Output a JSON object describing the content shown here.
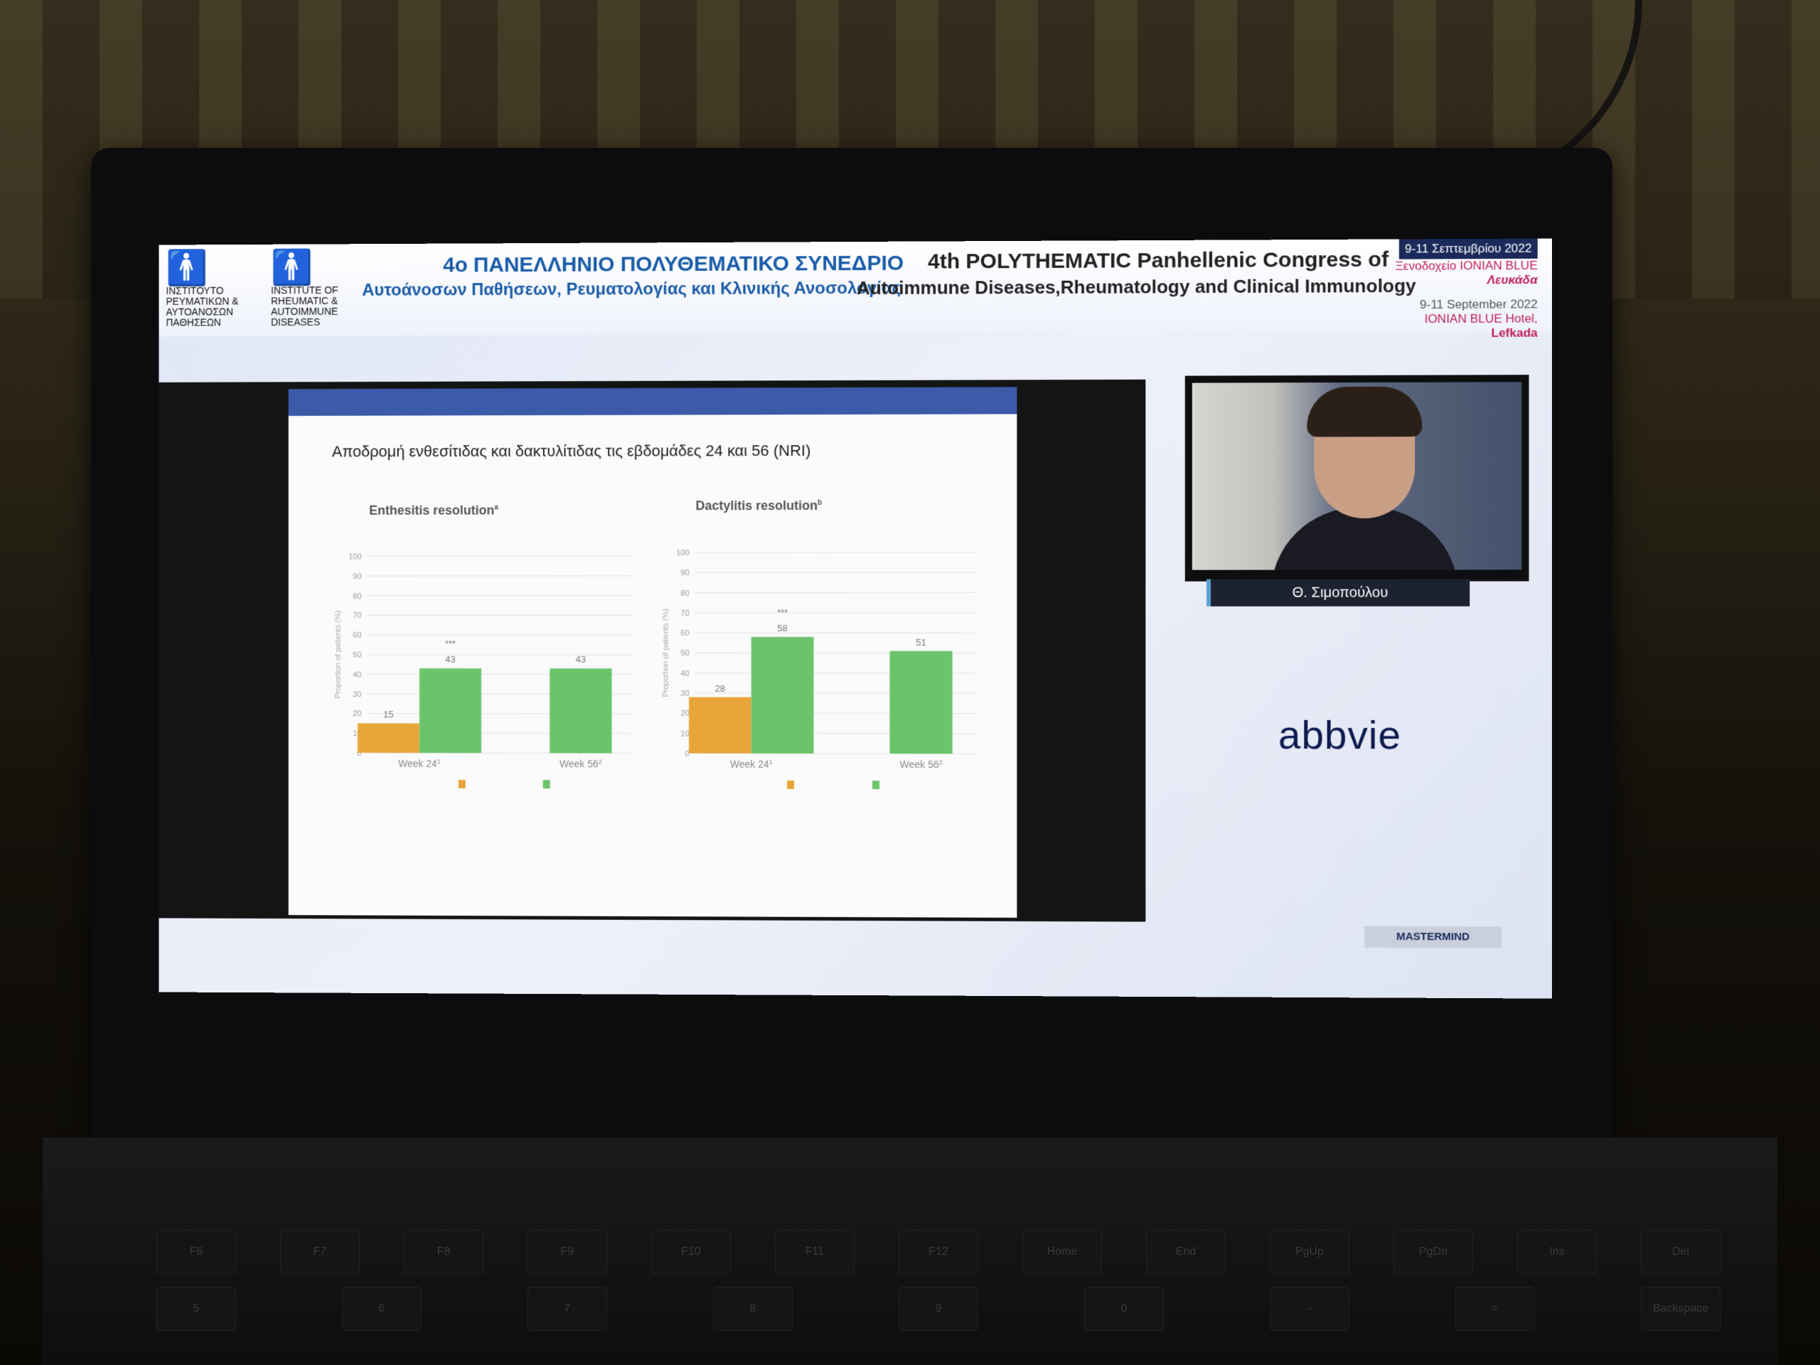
{
  "banner": {
    "logo1_text": "ΙΝΣΤΙΤΟΥΤΟ ΡΕΥΜΑΤΙΚΩΝ & ΑΥΤΟΑΝΟΣΩΝ ΠΑΘΗΣΕΩΝ",
    "logo2_text": "INSTITUTE OF RHEUMATIC & AUTOIMMUNE DISEASES",
    "gr_title_1": "4ο ΠΑΝΕΛΛΗΝΙΟ ΠΟΛΥΘΕΜΑΤΙΚΟ ΣΥΝΕΔΡΙΟ",
    "gr_title_2": "Αυτοάνοσων Παθήσεων, Ρευματολογίας και Κλινικής Ανοσολογίας",
    "en_title_1": "4th POLYTHEMATIC Panhellenic Congress of",
    "en_title_2": "Autoimmune Diseases,Rheumatology and Clinical Immunology",
    "date_gr": "9-11 Σεπτεμβρίου 2022",
    "hotel_gr": "Ξενοδοχείο IONIAN BLUE",
    "location_gr": "Λευκάδα",
    "date_en": "9-11 September 2022",
    "hotel_en": "IONIAN BLUE Hotel,",
    "location_en": "Lefkada"
  },
  "slide": {
    "title": "Αποδρομή ενθεσίτιδας και δακτυλίτιδας τις εβδομάδες 24 και 56 (NRI)"
  },
  "chart_data": [
    {
      "type": "bar",
      "title": "Enthesitis resolution",
      "title_superscript": "a",
      "ylabel": "Proportion of patients (%)",
      "ylim": [
        0,
        100
      ],
      "yticks": [
        0,
        10,
        20,
        30,
        40,
        50,
        60,
        70,
        80,
        90,
        100
      ],
      "categories": [
        "Week 24",
        "Week 56"
      ],
      "category_superscripts": [
        "1",
        "2"
      ],
      "series": [
        {
          "values": [
            15,
            null
          ],
          "color": "#e8a53a"
        },
        {
          "values": [
            43,
            43
          ],
          "color": "#6cc46a"
        }
      ],
      "annotations": [
        {
          "category": "Week 24",
          "text": "***"
        }
      ],
      "grid": true
    },
    {
      "type": "bar",
      "title": "Dactylitis resolution",
      "title_superscript": "b",
      "ylabel": "Proportion of patients (%)",
      "ylim": [
        0,
        100
      ],
      "yticks": [
        0,
        10,
        20,
        30,
        40,
        50,
        60,
        70,
        80,
        90,
        100
      ],
      "categories": [
        "Week 24",
        "Week 56"
      ],
      "category_superscripts": [
        "1",
        "2"
      ],
      "series": [
        {
          "values": [
            28,
            null
          ],
          "color": "#e8a53a"
        },
        {
          "values": [
            58,
            51
          ],
          "color": "#6cc46a"
        }
      ],
      "annotations": [
        {
          "category": "Week 24",
          "text": "***"
        }
      ],
      "grid": true
    }
  ],
  "speaker": {
    "name": "Θ. Σιμοπούλου"
  },
  "sponsor": {
    "name": "abbvie"
  },
  "footer": {
    "brand": "MASTERMIND"
  },
  "colors": {
    "banner_blue": "#1a5ca8",
    "slide_bar": "#3b5aa8",
    "pbo_bar": "#e8a53a",
    "upa_bar": "#6cc46a",
    "sponsor": "#0e1b4f"
  },
  "keyboard": {
    "row1": [
      "F6",
      "F7",
      "F8",
      "F9",
      "F10",
      "F11",
      "F12",
      "Home",
      "End",
      "PgUp",
      "PgDn",
      "Ins",
      "Del"
    ],
    "row2": [
      "5",
      "6",
      "7",
      "8",
      "9",
      "0",
      "-",
      "=",
      "Backspace"
    ]
  }
}
